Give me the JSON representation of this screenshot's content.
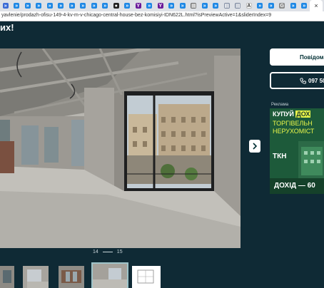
{
  "browser": {
    "url": "yavlenie/prodazh-ofisu-149-4-kv-m-v-chicago-central-house-bez-komisiyi-IDN622L.html?isPreviewActive=1&sliderIndex=9",
    "tab_icons": [
      {
        "name": "tab-icon",
        "color": "#3b6bd6",
        "glyph": "»"
      },
      {
        "name": "tab-icon",
        "color": "#1e88e5",
        "glyph": "»"
      },
      {
        "name": "tab-icon",
        "color": "#1e88e5",
        "glyph": "»"
      },
      {
        "name": "tab-icon",
        "color": "#1e88e5",
        "glyph": "»"
      },
      {
        "name": "tab-icon",
        "color": "#1e88e5",
        "glyph": "»"
      },
      {
        "name": "tab-icon",
        "color": "#1e88e5",
        "glyph": "»"
      },
      {
        "name": "tab-icon",
        "color": "#1e88e5",
        "glyph": "»"
      },
      {
        "name": "tab-icon",
        "color": "#1e88e5",
        "glyph": "»"
      },
      {
        "name": "tab-icon",
        "color": "#1e88e5",
        "glyph": "»"
      },
      {
        "name": "tab-icon",
        "color": "#1e88e5",
        "glyph": "»"
      },
      {
        "name": "tab-icon",
        "color": "#222222",
        "glyph": "●"
      },
      {
        "name": "tab-icon",
        "color": "#1e88e5",
        "glyph": "»"
      },
      {
        "name": "tab-icon",
        "color": "#6a1b9a",
        "glyph": "Y"
      },
      {
        "name": "tab-icon",
        "color": "#1e88e5",
        "glyph": "»"
      },
      {
        "name": "tab-icon",
        "color": "#6a1b9a",
        "glyph": "Y"
      },
      {
        "name": "tab-icon",
        "color": "#1e88e5",
        "glyph": "»"
      },
      {
        "name": "tab-icon",
        "color": "#1e88e5",
        "glyph": "»"
      },
      {
        "name": "tab-icon",
        "color": "#6a6a6a",
        "glyph": "▤"
      },
      {
        "name": "tab-icon",
        "color": "#1e88e5",
        "glyph": "»"
      },
      {
        "name": "tab-icon",
        "color": "#1e88e5",
        "glyph": "»"
      },
      {
        "name": "tab-icon",
        "color": "#7e8aa0",
        "glyph": "▤"
      },
      {
        "name": "tab-icon",
        "color": "#7e8aa0",
        "glyph": "▤"
      },
      {
        "name": "tab-icon",
        "color": "#ffffff",
        "glyph": "A",
        "text": "#333333"
      },
      {
        "name": "tab-icon",
        "color": "#1e88e5",
        "glyph": "»"
      },
      {
        "name": "tab-icon",
        "color": "#1e88e5",
        "glyph": "»"
      },
      {
        "name": "tab-icon",
        "color": "#8a8a8a",
        "glyph": "G"
      },
      {
        "name": "tab-icon",
        "color": "#1e88e5",
        "glyph": "»"
      },
      {
        "name": "tab-icon",
        "color": "#1e88e5",
        "glyph": "»"
      }
    ],
    "active_tab_close": "×",
    "trailing_tab_icons": [
      {
        "name": "tab-icon",
        "color": "#1e88e5",
        "glyph": "»"
      },
      {
        "name": "tab-icon",
        "color": "#1e88e5",
        "glyph": "»"
      },
      {
        "name": "tab-icon",
        "color": "#1e88e5",
        "glyph": "»"
      },
      {
        "name": "tab-icon",
        "color": "#1e88e5",
        "glyph": "»"
      },
      {
        "name": "tab-icon",
        "color": "#e6a700",
        "glyph": "▲"
      },
      {
        "name": "tab-icon",
        "color": "#1e88e5",
        "glyph": "»"
      },
      {
        "name": "tab-icon",
        "color": "#222222",
        "glyph": "T"
      },
      {
        "name": "tab-icon",
        "color": "#1e88e5",
        "glyph": "»"
      },
      {
        "name": "tab-icon",
        "color": "#8a8a8a",
        "glyph": "G"
      },
      {
        "name": "tab-icon",
        "color": "#1e88e5",
        "glyph": "»"
      }
    ]
  },
  "page": {
    "title": "их!",
    "background": "#0f2a35",
    "slider": {
      "current": "14",
      "total": "15"
    }
  },
  "actions": {
    "message_label": "Повідом",
    "phone_label": "097 50",
    "phone_icon": "phone-icon"
  },
  "ad": {
    "label": "Реклама",
    "headline_prefix": "КУПУЙ ",
    "headline_highlight": "ДОХ",
    "line2": "ТОРГІВЕЛЬН",
    "line3": "НЕРУХОМІСТ",
    "logo": "ТКН",
    "footer": "ДОХІД — 60"
  }
}
